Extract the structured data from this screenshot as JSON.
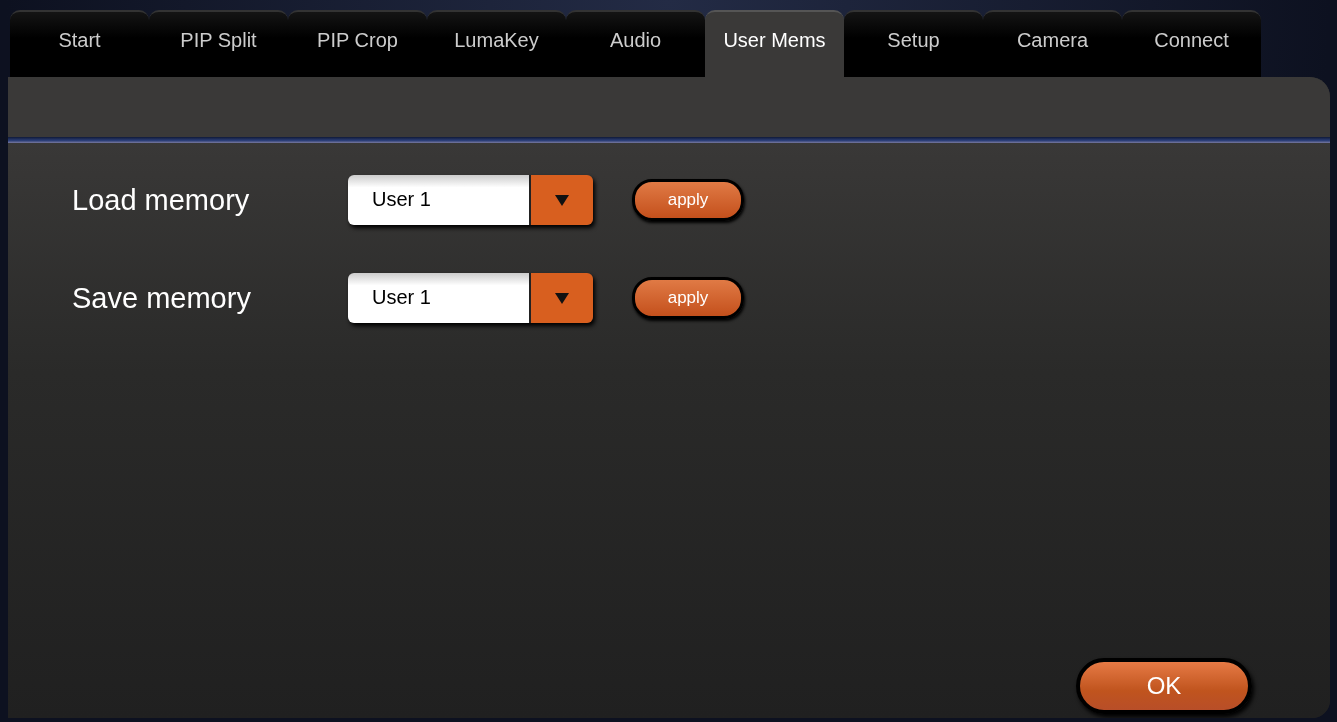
{
  "tabs": [
    {
      "label": "Start",
      "selected": false
    },
    {
      "label": "PIP Split",
      "selected": false
    },
    {
      "label": "PIP Crop",
      "selected": false
    },
    {
      "label": "LumaKey",
      "selected": false
    },
    {
      "label": "Audio",
      "selected": false
    },
    {
      "label": "User Mems",
      "selected": true
    },
    {
      "label": "Setup",
      "selected": false
    },
    {
      "label": "Camera",
      "selected": false
    },
    {
      "label": "Connect",
      "selected": false
    }
  ],
  "rows": [
    {
      "label": "Load memory",
      "value": "User 1",
      "button": "apply"
    },
    {
      "label": "Save memory",
      "value": "User 1",
      "button": "apply"
    }
  ],
  "ok_button": "OK"
}
